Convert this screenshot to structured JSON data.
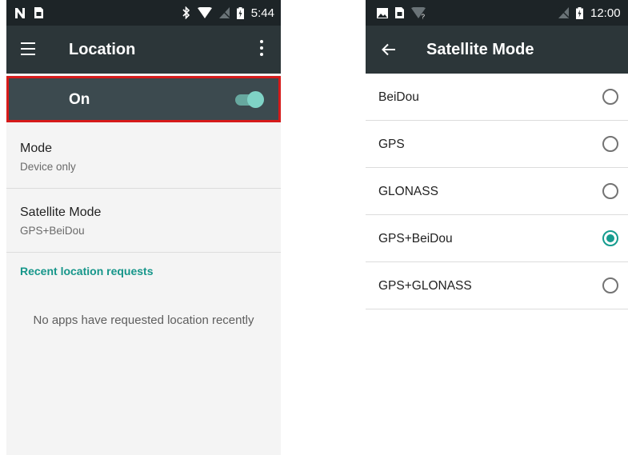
{
  "left_screen": {
    "status_bar": {
      "time": "5:44"
    },
    "toolbar": {
      "title": "Location"
    },
    "master_switch": {
      "label": "On",
      "checked": true,
      "highlight_color": "#d61a1a"
    },
    "preferences": [
      {
        "title": "Mode",
        "summary": "Device only"
      },
      {
        "title": "Satellite Mode",
        "summary": "GPS+BeiDou"
      }
    ],
    "recent_requests": {
      "category_label": "Recent location requests",
      "empty_message": "No apps have requested location recently"
    }
  },
  "right_screen": {
    "status_bar": {
      "time": "12:00"
    },
    "toolbar": {
      "title": "Satellite Mode"
    },
    "options": [
      {
        "label": "BeiDou",
        "selected": false
      },
      {
        "label": "GPS",
        "selected": false
      },
      {
        "label": "GLONASS",
        "selected": false
      },
      {
        "label": "GPS+BeiDou",
        "selected": true
      },
      {
        "label": "GPS+GLONASS",
        "selected": false
      }
    ]
  },
  "colors": {
    "status_bar": "#1d2427",
    "toolbar": "#2c3639",
    "accent": "#169c8f"
  }
}
